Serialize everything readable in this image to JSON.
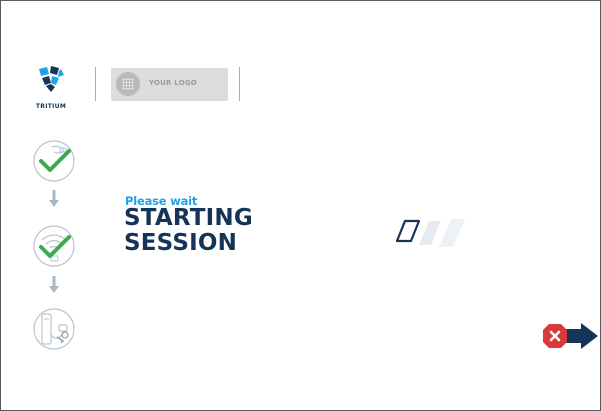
{
  "header": {
    "brand_name": "TRITIUM",
    "custom_logo_placeholder": "YOUR LOGO"
  },
  "progress_steps": [
    {
      "id": "plug-connected",
      "state": "completed",
      "icon": "charging-cable-check-icon"
    },
    {
      "id": "authorization",
      "state": "completed",
      "icon": "wireless-check-icon"
    },
    {
      "id": "start-session",
      "state": "pending",
      "icon": "charger-plug-icon"
    }
  ],
  "message": {
    "subtitle": "Please wait",
    "title_line_1": "STARTING",
    "title_line_2": "SESSION"
  },
  "loader": {
    "icon": "loading-stripes-icon"
  },
  "cancel": {
    "icon": "cancel-exit-icon"
  },
  "colors": {
    "navy": "#143557",
    "accent_blue": "#1ea3e6",
    "check_green": "#3cab4f",
    "cancel_red": "#d9383a",
    "muted_icon": "#b9c4cf"
  }
}
